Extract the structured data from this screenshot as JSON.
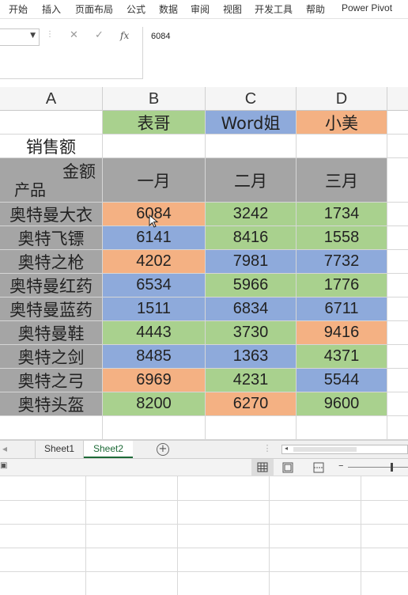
{
  "ribbon": {
    "tabs": [
      "开始",
      "插入",
      "页面布局",
      "公式",
      "数据",
      "审阅",
      "视图",
      "开发工具",
      "帮助",
      "Power Pivot"
    ]
  },
  "formula_bar": {
    "content": "6084",
    "fx_label": "fx",
    "cancel_glyph": "✕",
    "confirm_glyph": "✓"
  },
  "columns": [
    "A",
    "B",
    "C",
    "D"
  ],
  "persons": [
    "表哥",
    "Word姐",
    "小美"
  ],
  "sales_label": "销售额",
  "diagonal_header": {
    "top": "金额",
    "bottom": "产品"
  },
  "months": [
    "一月",
    "二月",
    "三月"
  ],
  "rows": [
    {
      "product": "奥特曼大衣",
      "values": [
        "6084",
        "3242",
        "1734"
      ]
    },
    {
      "product": "奥特飞镖",
      "values": [
        "6141",
        "8416",
        "1558"
      ]
    },
    {
      "product": "奥特之枪",
      "values": [
        "4202",
        "7981",
        "7732"
      ]
    },
    {
      "product": "奥特曼红药",
      "values": [
        "6534",
        "5966",
        "1776"
      ]
    },
    {
      "product": "奥特曼蓝药",
      "values": [
        "1511",
        "6834",
        "6711"
      ]
    },
    {
      "product": "奥特曼鞋",
      "values": [
        "4443",
        "3730",
        "9416"
      ]
    },
    {
      "product": "奥特之剑",
      "values": [
        "8485",
        "1363",
        "4371"
      ]
    },
    {
      "product": "奥特之弓",
      "values": [
        "6969",
        "4231",
        "5544"
      ]
    },
    {
      "product": "奥特头盔",
      "values": [
        "8200",
        "6270",
        "9600"
      ]
    }
  ],
  "fill_pattern": [
    [
      "orange",
      "green",
      "green"
    ],
    [
      "blue",
      "green",
      "green"
    ],
    [
      "orange",
      "blue",
      "blue"
    ],
    [
      "blue",
      "green",
      "green"
    ],
    [
      "blue",
      "blue",
      "blue"
    ],
    [
      "green",
      "green",
      "orange"
    ],
    [
      "blue",
      "blue",
      "green"
    ],
    [
      "orange",
      "green",
      "blue"
    ],
    [
      "green",
      "orange",
      "green"
    ]
  ],
  "person_fills": [
    "green",
    "blue",
    "orange"
  ],
  "colors": {
    "green": "#a9d18e",
    "blue": "#8eaadb",
    "orange": "#f4b183",
    "gray": "#a5a5a5",
    "accent": "#1d6a37"
  },
  "sheets": {
    "tabs": [
      "Sheet1",
      "Sheet2"
    ],
    "active": "Sheet2"
  },
  "icons": {
    "add_sheet": "plus-circle-icon",
    "view_normal": "grid-view-icon",
    "view_page_layout": "page-layout-icon",
    "view_page_break": "page-break-icon"
  }
}
